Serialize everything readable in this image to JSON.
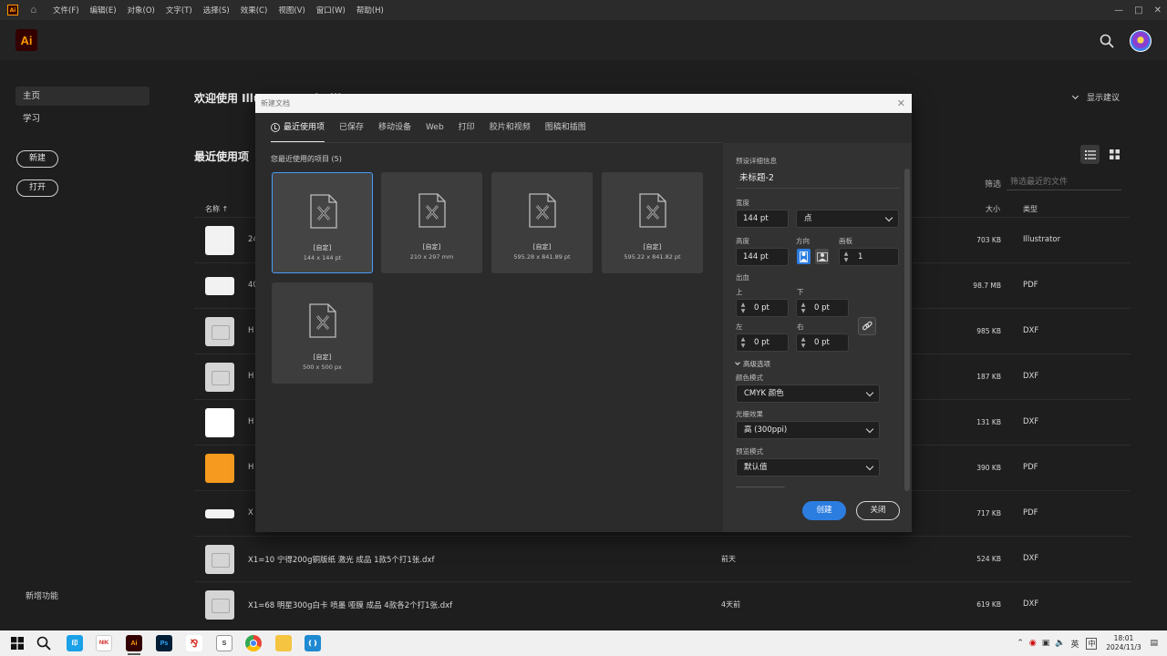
{
  "menubar": {
    "items": [
      "文件(F)",
      "编辑(E)",
      "对象(O)",
      "文字(T)",
      "选择(S)",
      "效果(C)",
      "视图(V)",
      "窗口(W)",
      "帮助(H)"
    ],
    "logo_text": "Ai"
  },
  "appbar": {
    "logo_text": "Ai"
  },
  "sidenav": {
    "home": "主页",
    "learn": "学习",
    "new_button": "新建",
    "open_button": "打开",
    "whats_new": "新增功能"
  },
  "main": {
    "welcome": "欢迎使用 Illustrator，helli",
    "show_suggestions": "显示建议",
    "recent_title": "最近使用项",
    "filter_label": "筛选",
    "filter_placeholder": "筛选最近的文件",
    "columns": {
      "name": "名称",
      "size": "大小",
      "type": "类型"
    },
    "rows": [
      {
        "name": "24",
        "date": "",
        "size": "703 KB",
        "type": "Illustrator",
        "thumb": "ai"
      },
      {
        "name": "40",
        "date": "",
        "size": "98.7 MB",
        "type": "PDF",
        "thumb": "pdf-wide"
      },
      {
        "name": "H",
        "date": "",
        "size": "985 KB",
        "type": "DXF",
        "thumb": "placeholder"
      },
      {
        "name": "H",
        "date": "",
        "size": "187 KB",
        "type": "DXF",
        "thumb": "placeholder"
      },
      {
        "name": "H",
        "date": "",
        "size": "131 KB",
        "type": "DXF",
        "thumb": "white"
      },
      {
        "name": "H",
        "date": "",
        "size": "390 KB",
        "type": "PDF",
        "thumb": "orange"
      },
      {
        "name": "X",
        "date": "",
        "size": "717 KB",
        "type": "PDF",
        "thumb": "strip"
      },
      {
        "name": "X1=10 宁得200g铜版纸 激光 成品 1款5个打1张.dxf",
        "date": "前天",
        "size": "524 KB",
        "type": "DXF",
        "thumb": "placeholder"
      },
      {
        "name": "X1=68 明星300g白卡 喷墨 哑膜 成品 4款各2个打1张.dxf",
        "date": "4天前",
        "size": "619 KB",
        "type": "DXF",
        "thumb": "placeholder"
      }
    ]
  },
  "dialog": {
    "title": "新建文档",
    "tabs": [
      "最近使用项",
      "已保存",
      "移动设备",
      "Web",
      "打印",
      "胶片和视频",
      "图稿和插图"
    ],
    "recent_label": "您最近使用的项目 (5)",
    "presets": [
      {
        "name": "[自定]",
        "dims": "144 x 144 pt",
        "selected": true
      },
      {
        "name": "[自定]",
        "dims": "210 x 297 mm",
        "selected": false
      },
      {
        "name": "[自定]",
        "dims": "595.28 x 841.89 pt",
        "selected": false
      },
      {
        "name": "[自定]",
        "dims": "595.22 x 841.82 pt",
        "selected": false
      },
      {
        "name": "[自定]",
        "dims": "500 x 500 px",
        "selected": false
      }
    ],
    "details": {
      "heading": "预设详细信息",
      "doc_name": "未标题-2",
      "width_label": "宽度",
      "width": "144 pt",
      "unit": "点",
      "height_label": "高度",
      "height": "144 pt",
      "orientation_label": "方向",
      "artboards_label": "画板",
      "artboards": "1",
      "bleed_label": "出血",
      "top_label": "上",
      "bottom_label": "下",
      "left_label": "左",
      "right_label": "右",
      "bleed_top": "0 pt",
      "bleed_bottom": "0 pt",
      "bleed_left": "0 pt",
      "bleed_right": "0 pt",
      "advanced_label": "高级选项",
      "color_mode_label": "颜色模式",
      "color_mode": "CMYK 颜色",
      "raster_label": "光栅效果",
      "raster": "高 (300ppi)",
      "preview_label": "预览模式",
      "preview": "默认值"
    },
    "create_button": "创建",
    "close_button": "关闭"
  },
  "taskbar": {
    "lang": "英",
    "ime": "中",
    "time": "18:01",
    "date": "2024/11/3"
  },
  "colors": {
    "accent": "#2c7de0",
    "selection": "#4a9df8",
    "ai_orange": "#ff9a00"
  }
}
